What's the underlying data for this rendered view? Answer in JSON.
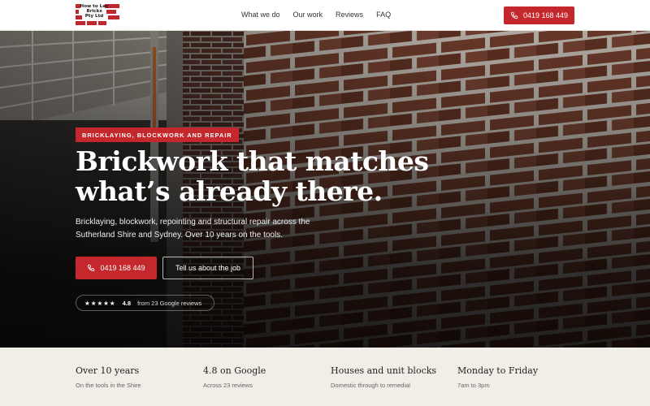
{
  "brand": {
    "logo_lines": [
      "How to Lay",
      "Bricks",
      "Pty Ltd"
    ],
    "logo_color": "#c0272d"
  },
  "nav": {
    "items": [
      "What we do",
      "Our work",
      "Reviews",
      "FAQ"
    ]
  },
  "header": {
    "phone_label": "0419 168 449"
  },
  "hero": {
    "badge": "BRICKLAYING, BLOCKWORK AND REPAIR",
    "headline_line1": "Brickwork that matches",
    "headline_line2": "what’s already there.",
    "subtitle": "Bricklaying, blockwork, repointing and structural repair across the Sutherland Shire and Sydney. Over 10 years on the tools.",
    "primary_button": "0419 168 449",
    "secondary_button": "Tell us about the job",
    "reviews": {
      "stars": "★★★★★",
      "rating": "4.8",
      "text": "from 23 Google reviews"
    }
  },
  "stats": [
    {
      "title": "Over 10 years",
      "sub": "On the tools in the Shire"
    },
    {
      "title": "4.8 on Google",
      "sub": "Across 23 reviews"
    },
    {
      "title": "Houses and unit blocks",
      "sub": "Domestic through to remedial"
    },
    {
      "title": "Monday to Friday",
      "sub": "7am to 3pm"
    }
  ],
  "colors": {
    "accent": "#c4282d",
    "stats_bg": "#f1ede7"
  }
}
